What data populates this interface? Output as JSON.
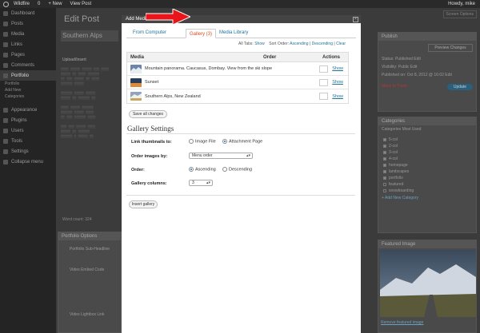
{
  "admin_bar": {
    "site": "Wildfire",
    "comments": "0",
    "new": "+ New",
    "view_post": "View Post",
    "howdy": "Howdy, mike"
  },
  "sidebar": {
    "items": [
      "Dashboard",
      "Posts",
      "Media",
      "Links",
      "Pages",
      "Comments",
      "Portfolio"
    ],
    "sub_items": [
      "Portfolio",
      "Add New",
      "Categories"
    ],
    "items2": [
      "Appearance",
      "Plugins",
      "Users",
      "Tools",
      "Settings",
      "Collapse menu"
    ]
  },
  "background": {
    "page_title": "Edit Post",
    "screen_options": "Screen Options",
    "post_title": "Southern Alps",
    "publish_header": "Publish",
    "preview_changes": "Preview Changes",
    "status": "Status: Published Edit",
    "visibility": "Visibility: Public Edit",
    "published_on": "Published on: Oct 8, 2012 @ 16:02 Edit",
    "move_to_trash": "Move to Trash",
    "update": "Update",
    "categories_header": "Categories",
    "categories_tabs": "Categories   Most Used",
    "categories": [
      "5-col",
      "2-col",
      "3-col",
      "4-col",
      "homepage",
      "landscapes",
      "portfolio",
      "featured",
      "snowboarding"
    ],
    "add_category": "+ Add New Category",
    "featured_header": "Featured Image",
    "remove_featured": "Remove featured image",
    "portfolio_options": "Portfolio Options",
    "po_fields": [
      "Portfolio Sub-Headline",
      "Video Embed Code",
      "Video Lightbox Link"
    ],
    "word_count": "Word count: 324",
    "upload_insert": "Upload/Insert"
  },
  "modal": {
    "title": "Add Media",
    "close": "×",
    "tabs": [
      {
        "label": "From Computer"
      },
      {
        "label": "Gallery (3)"
      },
      {
        "label": "Media Library"
      }
    ],
    "sort_bar": {
      "all_tabs": "All Tabs:",
      "show": "Show",
      "sort_order": "Sort Order:",
      "ascending": "Ascending",
      "descending": "Descending",
      "clear": "Clear"
    },
    "table": {
      "col_media": "Media",
      "col_order": "Order",
      "col_actions": "Actions",
      "rows": [
        {
          "title": "Mountain panorama. Caucasus, Dombay. View from the ski slope",
          "action": "Show"
        },
        {
          "title": "Sunset",
          "action": "Show"
        },
        {
          "title": "Southern Alps, New Zealand",
          "action": "Show"
        }
      ]
    },
    "save_all": "Save all changes",
    "gallery_settings": {
      "title": "Gallery Settings",
      "link_label": "Link thumbnails to:",
      "link_opts": [
        "Image File",
        "Attachment Page"
      ],
      "order_by_label": "Order images by:",
      "order_by_value": "Menu order",
      "order_label": "Order:",
      "order_opts": [
        "Ascending",
        "Descending"
      ],
      "columns_label": "Gallery columns:",
      "columns_value": "3"
    },
    "insert_gallery": "Insert gallery"
  },
  "colors": {
    "link": "#21759b",
    "active_tab": "#d54e21",
    "arrow": "#e8151b"
  }
}
